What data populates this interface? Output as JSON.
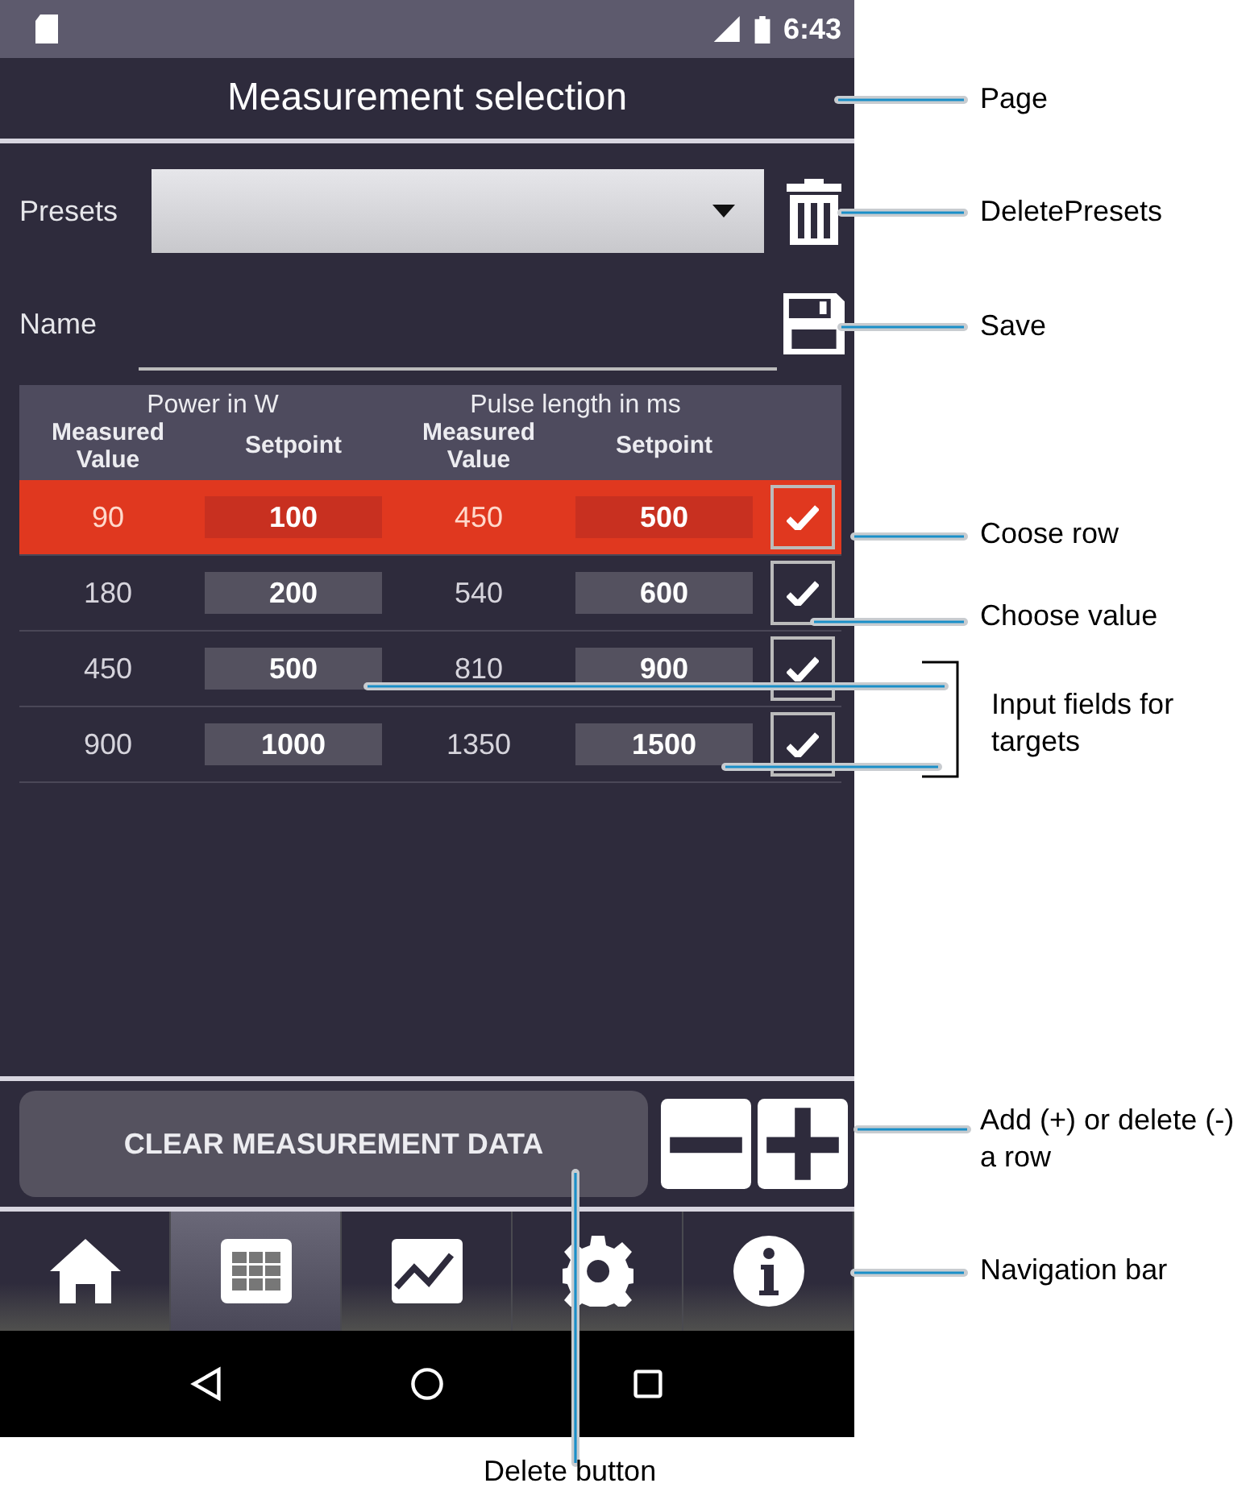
{
  "status_bar": {
    "time": "6:43"
  },
  "page": {
    "title": "Measurement selection"
  },
  "presets": {
    "label": "Presets"
  },
  "name": {
    "label": "Name"
  },
  "table": {
    "groups": [
      "Power in W",
      "Pulse length in ms"
    ],
    "columns": [
      "Measured Value",
      "Setpoint",
      "Measured Value",
      "Setpoint"
    ],
    "rows": [
      {
        "power_measured": "90",
        "power_setpoint": "100",
        "pulse_measured": "450",
        "pulse_setpoint": "500",
        "selected": true,
        "checked": true
      },
      {
        "power_measured": "180",
        "power_setpoint": "200",
        "pulse_measured": "540",
        "pulse_setpoint": "600",
        "selected": false,
        "checked": true
      },
      {
        "power_measured": "450",
        "power_setpoint": "500",
        "pulse_measured": "810",
        "pulse_setpoint": "900",
        "selected": false,
        "checked": true
      },
      {
        "power_measured": "900",
        "power_setpoint": "1000",
        "pulse_measured": "1350",
        "pulse_setpoint": "1500",
        "selected": false,
        "checked": true
      }
    ]
  },
  "clear_button": {
    "label": "CLEAR MEASUREMENT DATA"
  },
  "nav": [
    {
      "kind": "home",
      "selected": false
    },
    {
      "kind": "table",
      "selected": true
    },
    {
      "kind": "chart",
      "selected": false
    },
    {
      "kind": "gear",
      "selected": false
    },
    {
      "kind": "info",
      "selected": false
    }
  ],
  "annotations": [
    "Page",
    "DeletePresets",
    "Save",
    "Coose row",
    "Choose value",
    "Input fields for targets",
    "Add (+) or delete (-) a row",
    "Navigation bar",
    "Delete button"
  ]
}
